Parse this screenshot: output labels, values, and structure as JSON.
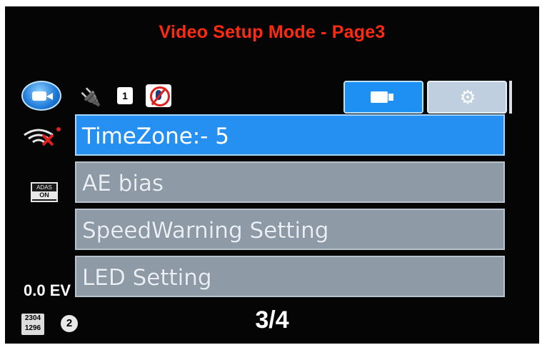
{
  "header": {
    "title": "Video Setup Mode - Page3"
  },
  "status": {
    "sd_card": "1",
    "adas_label": "ADAS",
    "adas_state": "ON",
    "ev_value": "0.0 EV",
    "resolution_top": "2304",
    "resolution_bottom": "1296",
    "loop_minutes": "2"
  },
  "tabs": [
    {
      "name": "video",
      "icon": "video-camera-icon",
      "active": true
    },
    {
      "name": "settings",
      "icon": "gear-icon",
      "active": false
    }
  ],
  "menu": {
    "items": [
      {
        "label": "TimeZone:- 5",
        "selected": true
      },
      {
        "label": "AE bias",
        "selected": false
      },
      {
        "label": "SpeedWarning Setting",
        "selected": false
      },
      {
        "label": "LED Setting",
        "selected": false
      }
    ]
  },
  "pagination": {
    "label": "3/4"
  },
  "colors": {
    "title_red": "#ff2a10",
    "selected_blue": "#2590f2",
    "item_gray": "#8e9aa6",
    "background": "#050505"
  }
}
